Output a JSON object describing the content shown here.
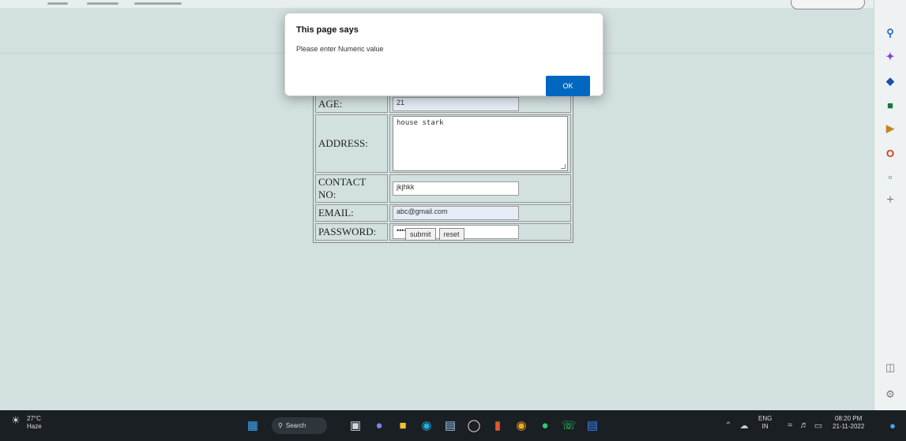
{
  "dialog": {
    "title": "This page says",
    "message": "Please enter Numeric value",
    "ok_label": "OK"
  },
  "form": {
    "age_label": "AGE:",
    "age_value": "21",
    "address_label": "ADDRESS:",
    "address_value": "house stark",
    "contact_label": "CONTACT NO:",
    "contact_value": "jkjhkk",
    "email_label": "EMAIL:",
    "email_value": "abc@gmail.com",
    "password_label": "PASSWORD:",
    "password_value": "••••••",
    "submit_label": "submit",
    "reset_label": "reset"
  },
  "taskbar": {
    "temperature": "27°C",
    "weather": "Haze",
    "search_label": "Search",
    "lang_top": "ENG",
    "lang_bottom": "IN",
    "time": "08:20 PM",
    "date": "21-11-2022"
  },
  "icons": {
    "sidebar": [
      "search-icon",
      "sparkle-icon",
      "tag-icon",
      "briefcase-icon",
      "games-icon",
      "office-icon",
      "outlook-icon",
      "add-icon",
      "layout-icon",
      "settings-icon"
    ]
  },
  "colors": {
    "page_bg": "#d3e0e0",
    "ok_button": "#0067c0",
    "taskbar_bg": "#1a1f24"
  }
}
